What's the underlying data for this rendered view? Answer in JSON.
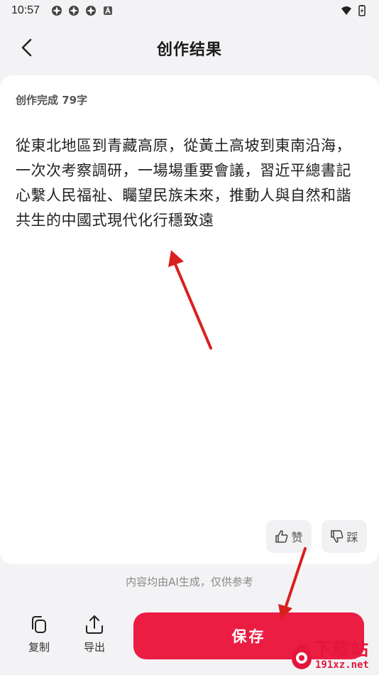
{
  "status_bar": {
    "time": "10:57"
  },
  "header": {
    "title": "创作结果"
  },
  "card": {
    "meta": "创作完成 79字",
    "content": "從東北地區到青藏高原，從黃土高坡到東南沿海，一次次考察調研，一場場重要會議，習近平總書記心繫人民福祉、矚望民族未來，推動人與自然和諧共生的中國式現代化行穩致遠",
    "like_label": "赞",
    "dislike_label": "踩"
  },
  "disclaimer": "内容均由AI生成，仅供参考",
  "toolbar": {
    "copy_label": "复制",
    "export_label": "导出",
    "save_label": "保存"
  },
  "watermark": {
    "top": "下载站",
    "bottom": "191xz.net"
  },
  "colors": {
    "accent": "#eb1d43",
    "arrow": "#d8201f"
  }
}
